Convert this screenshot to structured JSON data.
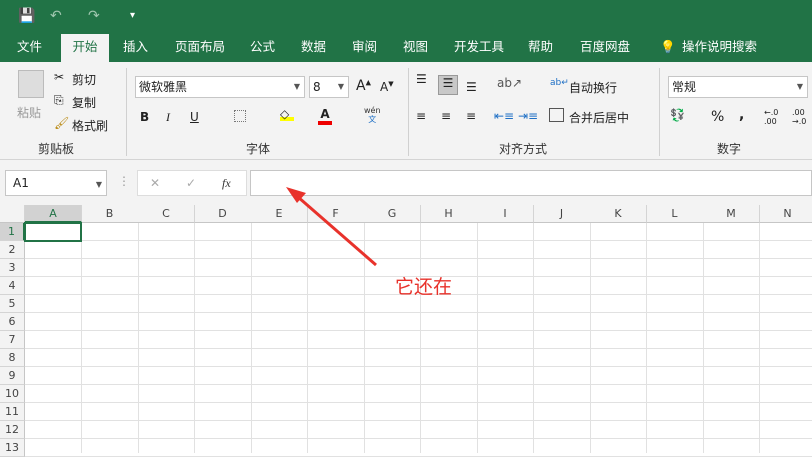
{
  "qat": {
    "save": "💾",
    "undo": "↶",
    "redo": "↷",
    "customize": "▾"
  },
  "tabs": [
    "文件",
    "开始",
    "插入",
    "页面布局",
    "公式",
    "数据",
    "审阅",
    "视图",
    "开发工具",
    "帮助",
    "百度网盘",
    "操作说明搜索"
  ],
  "clipboard": {
    "paste": "粘贴",
    "cut": "剪切",
    "copy": "复制",
    "format_painter": "格式刷",
    "label": "剪贴板"
  },
  "font": {
    "name": "微软雅黑",
    "size": "8",
    "bold": "B",
    "italic": "I",
    "underline": "U",
    "phonetic": "wén",
    "label": "字体"
  },
  "alignment": {
    "wrap": "自动换行",
    "merge": "合并后居中",
    "label": "对齐方式"
  },
  "number": {
    "format": "常规",
    "percent": "%",
    "comma": ",",
    "inc": "←.0\n.00",
    "dec": ".00\n→.0",
    "label": "数字"
  },
  "formula_bar": {
    "name_box": "A1",
    "fx": "fx",
    "value": ""
  },
  "columns": [
    "A",
    "B",
    "C",
    "D",
    "E",
    "F",
    "G",
    "H",
    "I",
    "J",
    "K",
    "L",
    "M",
    "N"
  ],
  "rows": [
    "1",
    "2",
    "3",
    "4",
    "5",
    "6",
    "7",
    "8",
    "9",
    "10",
    "11",
    "12",
    "13"
  ],
  "annotation": {
    "text": "它还在",
    "color": "#e8322b"
  },
  "colors": {
    "accent": "#217346"
  }
}
